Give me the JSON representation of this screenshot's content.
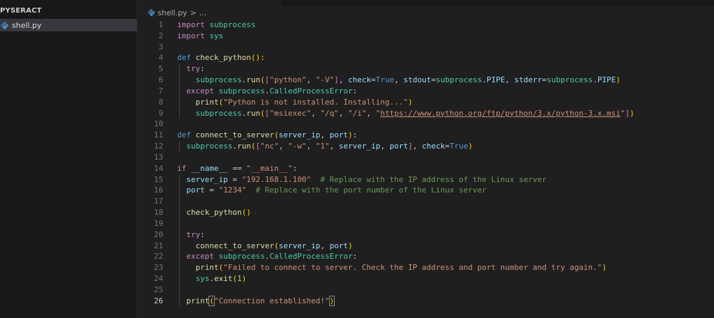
{
  "explorer": {
    "title": "PYSERACT",
    "file": "shell.py"
  },
  "breadcrumb": {
    "file": "shell.py",
    "separator": ">",
    "rest": "..."
  },
  "editor": {
    "current_line": 26
  },
  "lines": [
    {
      "n": "1",
      "indent": 0,
      "tokens": [
        {
          "t": "import",
          "c": "ctl"
        },
        {
          "t": " "
        },
        {
          "t": "subprocess",
          "c": "cls"
        }
      ]
    },
    {
      "n": "2",
      "indent": 0,
      "tokens": [
        {
          "t": "import",
          "c": "ctl"
        },
        {
          "t": " "
        },
        {
          "t": "sys",
          "c": "cls"
        }
      ]
    },
    {
      "n": "3",
      "indent": 0,
      "tokens": []
    },
    {
      "n": "4",
      "indent": 0,
      "tokens": [
        {
          "t": "def",
          "c": "kw"
        },
        {
          "t": " "
        },
        {
          "t": "check_python",
          "c": "fn"
        },
        {
          "t": "():",
          "c": "brk1"
        }
      ]
    },
    {
      "n": "5",
      "indent": 1,
      "tokens": [
        {
          "t": "try",
          "c": "ctl"
        },
        {
          "t": ":"
        }
      ]
    },
    {
      "n": "6",
      "indent": 2,
      "tokens": [
        {
          "t": "subprocess",
          "c": "cls"
        },
        {
          "t": "."
        },
        {
          "t": "run",
          "c": "fn"
        },
        {
          "t": "(",
          "c": "brk1"
        },
        {
          "t": "[",
          "c": "brk2"
        },
        {
          "t": "\"python\"",
          "c": "str"
        },
        {
          "t": ", "
        },
        {
          "t": "\"-V\"",
          "c": "str"
        },
        {
          "t": "]",
          "c": "brk2"
        },
        {
          "t": ", "
        },
        {
          "t": "check",
          "c": "var"
        },
        {
          "t": "="
        },
        {
          "t": "True",
          "c": "kw"
        },
        {
          "t": ", "
        },
        {
          "t": "stdout",
          "c": "var"
        },
        {
          "t": "="
        },
        {
          "t": "subprocess",
          "c": "cls"
        },
        {
          "t": "."
        },
        {
          "t": "PIPE",
          "c": "var"
        },
        {
          "t": ", "
        },
        {
          "t": "stderr",
          "c": "var"
        },
        {
          "t": "="
        },
        {
          "t": "subprocess",
          "c": "cls"
        },
        {
          "t": "."
        },
        {
          "t": "PIPE",
          "c": "var"
        },
        {
          "t": ")",
          "c": "brk1"
        }
      ]
    },
    {
      "n": "7",
      "indent": 1,
      "tokens": [
        {
          "t": "except",
          "c": "ctl"
        },
        {
          "t": " "
        },
        {
          "t": "subprocess",
          "c": "cls"
        },
        {
          "t": "."
        },
        {
          "t": "CalledProcessError",
          "c": "cls"
        },
        {
          "t": ":"
        }
      ]
    },
    {
      "n": "8",
      "indent": 2,
      "tokens": [
        {
          "t": "print",
          "c": "fn"
        },
        {
          "t": "(",
          "c": "brk1"
        },
        {
          "t": "\"Python is not installed. Installing...\"",
          "c": "str"
        },
        {
          "t": ")",
          "c": "brk1"
        }
      ]
    },
    {
      "n": "9",
      "indent": 2,
      "tokens": [
        {
          "t": "subprocess",
          "c": "cls"
        },
        {
          "t": "."
        },
        {
          "t": "run",
          "c": "fn"
        },
        {
          "t": "(",
          "c": "brk1"
        },
        {
          "t": "[",
          "c": "brk2"
        },
        {
          "t": "\"msiexec\"",
          "c": "str"
        },
        {
          "t": ", "
        },
        {
          "t": "\"/q\"",
          "c": "str"
        },
        {
          "t": ", "
        },
        {
          "t": "\"/i\"",
          "c": "str"
        },
        {
          "t": ", "
        },
        {
          "t": "\"",
          "c": "str"
        },
        {
          "t": "https://www.python.org/ftp/python/3.x/python-3.x.msi",
          "c": "str url"
        },
        {
          "t": "\"",
          "c": "str"
        },
        {
          "t": "]",
          "c": "brk2"
        },
        {
          "t": ")",
          "c": "brk1"
        }
      ]
    },
    {
      "n": "10",
      "indent": 0,
      "tokens": []
    },
    {
      "n": "11",
      "indent": 0,
      "tokens": [
        {
          "t": "def",
          "c": "kw"
        },
        {
          "t": " "
        },
        {
          "t": "connect_to_server",
          "c": "fn"
        },
        {
          "t": "(",
          "c": "brk1"
        },
        {
          "t": "server_ip",
          "c": "var"
        },
        {
          "t": ", "
        },
        {
          "t": "port",
          "c": "var"
        },
        {
          "t": ")",
          "c": "brk1"
        },
        {
          "t": ":"
        }
      ]
    },
    {
      "n": "12",
      "indent": 1,
      "tokens": [
        {
          "t": "subprocess",
          "c": "cls"
        },
        {
          "t": "."
        },
        {
          "t": "run",
          "c": "fn"
        },
        {
          "t": "(",
          "c": "brk1"
        },
        {
          "t": "[",
          "c": "brk2"
        },
        {
          "t": "\"nc\"",
          "c": "str"
        },
        {
          "t": ", "
        },
        {
          "t": "\"-w\"",
          "c": "str"
        },
        {
          "t": ", "
        },
        {
          "t": "\"1\"",
          "c": "str"
        },
        {
          "t": ", "
        },
        {
          "t": "server_ip",
          "c": "var"
        },
        {
          "t": ", "
        },
        {
          "t": "port",
          "c": "var"
        },
        {
          "t": "]",
          "c": "brk2"
        },
        {
          "t": ", "
        },
        {
          "t": "check",
          "c": "var"
        },
        {
          "t": "="
        },
        {
          "t": "True",
          "c": "kw"
        },
        {
          "t": ")",
          "c": "brk1"
        }
      ]
    },
    {
      "n": "13",
      "indent": 0,
      "tokens": []
    },
    {
      "n": "14",
      "indent": 0,
      "tokens": [
        {
          "t": "if",
          "c": "ctl"
        },
        {
          "t": " "
        },
        {
          "t": "__name__",
          "c": "var"
        },
        {
          "t": " == "
        },
        {
          "t": "\"__main__\"",
          "c": "str"
        },
        {
          "t": ":"
        }
      ]
    },
    {
      "n": "15",
      "indent": 1,
      "tokens": [
        {
          "t": "server_ip",
          "c": "var"
        },
        {
          "t": " = "
        },
        {
          "t": "\"192.168.1.100\"",
          "c": "str"
        },
        {
          "t": "  "
        },
        {
          "t": "# Replace with the IP address of the Linux server",
          "c": "cm"
        }
      ]
    },
    {
      "n": "16",
      "indent": 1,
      "tokens": [
        {
          "t": "port",
          "c": "var"
        },
        {
          "t": " = "
        },
        {
          "t": "\"1234\"",
          "c": "str"
        },
        {
          "t": "  "
        },
        {
          "t": "# Replace with the port number of the Linux server",
          "c": "cm"
        }
      ]
    },
    {
      "n": "17",
      "indent": 1,
      "tokens": []
    },
    {
      "n": "18",
      "indent": 1,
      "tokens": [
        {
          "t": "check_python",
          "c": "fn"
        },
        {
          "t": "()",
          "c": "brk1"
        }
      ]
    },
    {
      "n": "19",
      "indent": 1,
      "tokens": []
    },
    {
      "n": "20",
      "indent": 1,
      "tokens": [
        {
          "t": "try",
          "c": "ctl"
        },
        {
          "t": ":"
        }
      ]
    },
    {
      "n": "21",
      "indent": 2,
      "tokens": [
        {
          "t": "connect_to_server",
          "c": "fn"
        },
        {
          "t": "(",
          "c": "brk1"
        },
        {
          "t": "server_ip",
          "c": "var"
        },
        {
          "t": ", "
        },
        {
          "t": "port",
          "c": "var"
        },
        {
          "t": ")",
          "c": "brk1"
        }
      ]
    },
    {
      "n": "22",
      "indent": 1,
      "tokens": [
        {
          "t": "except",
          "c": "ctl"
        },
        {
          "t": " "
        },
        {
          "t": "subprocess",
          "c": "cls"
        },
        {
          "t": "."
        },
        {
          "t": "CalledProcessError",
          "c": "cls"
        },
        {
          "t": ":"
        }
      ]
    },
    {
      "n": "23",
      "indent": 2,
      "tokens": [
        {
          "t": "print",
          "c": "fn"
        },
        {
          "t": "(",
          "c": "brk1"
        },
        {
          "t": "\"Failed to connect to server. Check the IP address and port number and try again.\"",
          "c": "str"
        },
        {
          "t": ")",
          "c": "brk1"
        }
      ]
    },
    {
      "n": "24",
      "indent": 2,
      "tokens": [
        {
          "t": "sys",
          "c": "cls"
        },
        {
          "t": "."
        },
        {
          "t": "exit",
          "c": "fn"
        },
        {
          "t": "(",
          "c": "brk1"
        },
        {
          "t": "1",
          "c": "num"
        },
        {
          "t": ")",
          "c": "brk1"
        }
      ]
    },
    {
      "n": "25",
      "indent": 1,
      "tokens": []
    },
    {
      "n": "26",
      "indent": 1,
      "tokens": [
        {
          "t": "print",
          "c": "fn"
        },
        {
          "t": "(",
          "c": "brk1 match"
        },
        {
          "t": "\"Connection established!\"",
          "c": "str"
        },
        {
          "t": ")",
          "c": "brk1 match"
        }
      ]
    }
  ],
  "guides": [
    {
      "from": 5,
      "to": 9,
      "level": 1
    },
    {
      "from": 12,
      "to": 12,
      "level": 1
    },
    {
      "from": 15,
      "to": 26,
      "level": 1
    }
  ],
  "colors": {
    "keyword": "#569cd6",
    "control": "#c586c0",
    "function": "#dcdcaa",
    "string": "#ce9178",
    "comment": "#6a9955",
    "number": "#b5cea8",
    "variable": "#9cdcfe",
    "class": "#4ec9b0",
    "background": "#1f1f1f",
    "sidebar": "#181818",
    "selection": "#37373d"
  },
  "icons": {
    "file": "python-file-icon",
    "breadcrumb": "python-file-icon"
  }
}
